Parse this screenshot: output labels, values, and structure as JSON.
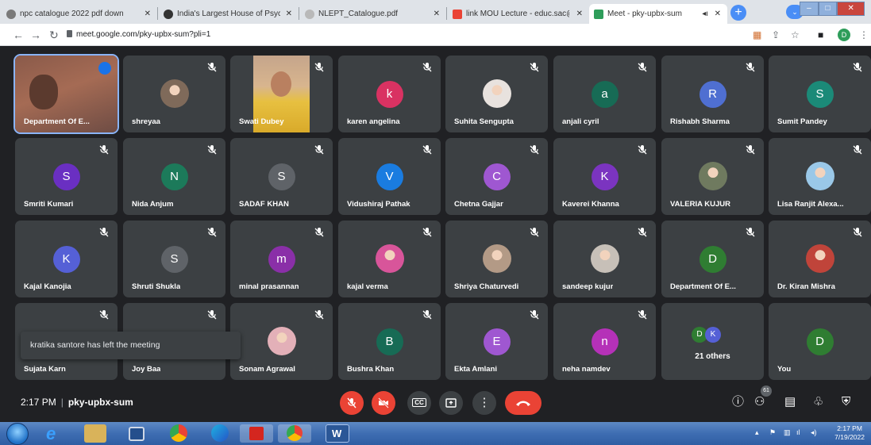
{
  "browser": {
    "tabs": [
      {
        "title": "npc catalogue 2022 pdf down",
        "fav": "#7a7a7a"
      },
      {
        "title": "India's Largest House of Psych",
        "fav": "#333333"
      },
      {
        "title": "NLEPT_Catalogue.pdf",
        "fav": "#b9b9b9"
      },
      {
        "title": "link MOU Lecture - educ.sac@",
        "fav": "#ea4335"
      },
      {
        "title": "Meet - pky-upbx-sum",
        "fav": "#2e9d5a"
      }
    ],
    "new_tab_label": "+",
    "url": "meet.google.com/pky-upbx-sum?pli=1",
    "profile_letter": "D",
    "window_controls": {
      "minimize": "–",
      "maximize": "□",
      "close": "✕"
    }
  },
  "participants": [
    {
      "name": "Department Of E...",
      "kind": "video1"
    },
    {
      "name": "shreyaa",
      "kind": "photo",
      "color": "#7f6a5a"
    },
    {
      "name": "Swati Dubey",
      "kind": "video2"
    },
    {
      "name": "karen angelina",
      "kind": "letter",
      "letter": "k",
      "color": "#d93262"
    },
    {
      "name": "Suhita Sengupta",
      "kind": "photo",
      "color": "#e8e2de"
    },
    {
      "name": "anjali cyril",
      "kind": "letter",
      "letter": "a",
      "color": "#176b55"
    },
    {
      "name": "Rishabh Sharma",
      "kind": "letter",
      "letter": "R",
      "color": "#4f6fd1"
    },
    {
      "name": "Sumit Pandey",
      "kind": "letter",
      "letter": "S",
      "color": "#1b8a78"
    },
    {
      "name": "Smriti Kumari",
      "kind": "letter",
      "letter": "S",
      "color": "#6a2fc2"
    },
    {
      "name": "Nida Anjum",
      "kind": "letter",
      "letter": "N",
      "color": "#1c7a5a"
    },
    {
      "name": "SADAF KHAN",
      "kind": "letter",
      "letter": "S",
      "color": "#5f6368"
    },
    {
      "name": "Vidushiraj Pathak",
      "kind": "letter",
      "letter": "V",
      "color": "#1a7ce0"
    },
    {
      "name": "Chetna Gajjar",
      "kind": "letter",
      "letter": "C",
      "color": "#9f57d1"
    },
    {
      "name": "Kaverei Khanna",
      "kind": "letter",
      "letter": "K",
      "color": "#7b34c0"
    },
    {
      "name": "VALERIA KUJUR",
      "kind": "photo",
      "color": "#6f7a5f"
    },
    {
      "name": "Lisa Ranjit Alexa...",
      "kind": "photo",
      "color": "#9ac8e8"
    },
    {
      "name": "Kajal Kanojia",
      "kind": "letter",
      "letter": "K",
      "color": "#5560d6"
    },
    {
      "name": "Shruti Shukla",
      "kind": "letter",
      "letter": "S",
      "color": "#5f6368"
    },
    {
      "name": "minal prasannan",
      "kind": "letter",
      "letter": "m",
      "color": "#8a2fa8"
    },
    {
      "name": "kajal verma",
      "kind": "photo",
      "color": "#d8559a"
    },
    {
      "name": "Shriya Chaturvedi",
      "kind": "photo",
      "color": "#b39a86"
    },
    {
      "name": "sandeep kujur",
      "kind": "photo",
      "color": "#c7c0b8"
    },
    {
      "name": "Department Of E...",
      "kind": "letter",
      "letter": "D",
      "color": "#2f7d32"
    },
    {
      "name": "Dr. Kiran Mishra",
      "kind": "photo",
      "color": "#c0443a"
    },
    {
      "name": "Sujata Karn",
      "kind": "hidden"
    },
    {
      "name": "Joy Baa",
      "kind": "hidden"
    },
    {
      "name": "Sonam Agrawal",
      "kind": "photo",
      "color": "#e3b0b8"
    },
    {
      "name": "Bushra Khan",
      "kind": "letter",
      "letter": "B",
      "color": "#176b55"
    },
    {
      "name": "Ekta Amlani",
      "kind": "letter",
      "letter": "E",
      "color": "#9f57d1"
    },
    {
      "name": "neha namdev",
      "kind": "letter",
      "letter": "n",
      "color": "#b531b8"
    },
    {
      "name": "21 others",
      "kind": "others",
      "letters": [
        "D",
        "K"
      ],
      "colors": [
        "#2f7d32",
        "#5560d6"
      ]
    },
    {
      "name": "You",
      "kind": "letter",
      "letter": "D",
      "color": "#2f7d32"
    }
  ],
  "toast": "kratika santore has left the meeting",
  "meeting": {
    "time": "2:17 PM",
    "separator": "|",
    "code": "pky-upbx-sum"
  },
  "controls": {
    "mic": "mic-off",
    "camera": "camera-off",
    "captions": "CC",
    "present": "present",
    "more": "⋮",
    "leave": "leave"
  },
  "people_count": "61",
  "taskbar": {
    "clock_time": "2:17 PM",
    "clock_date": "7/19/2022"
  },
  "colors": {
    "meet_bg": "#202124",
    "tile_bg": "#3c4043",
    "danger": "#ea4335",
    "accent": "#1a73e8"
  }
}
